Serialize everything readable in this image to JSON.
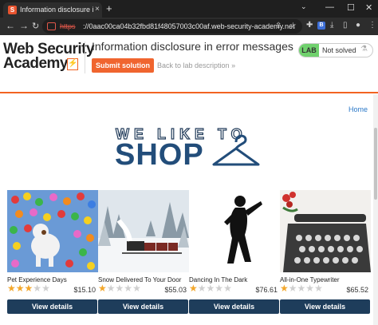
{
  "browser": {
    "tab_title": "Information disclosure in error m",
    "tab_close": "×",
    "new_tab": "+",
    "minimize": "—",
    "maximize": "☐",
    "close": "✕",
    "url_scheme": "https",
    "url": "://0aac00ca04b32fbd81f48057003c00af.web-security-academy.net"
  },
  "header": {
    "logo_line1": "Web Security",
    "logo_line2": "Academy",
    "logo_mark": "⚡",
    "lab_title": "Information disclosure in error messages",
    "submit_label": "Submit solution",
    "back_label": "Back to lab description",
    "back_arrow": "»",
    "lab_badge": "LAB",
    "status": "Not solved",
    "home_link": "Home"
  },
  "banner": {
    "we_like": "WE LIKE TO",
    "shop": "SHOP"
  },
  "products": [
    {
      "name": "Pet Experience Days",
      "rating": 3,
      "price": "$15.10",
      "button": "View details"
    },
    {
      "name": "Snow Delivered To Your Door",
      "rating": 1,
      "price": "$55.03",
      "button": "View details"
    },
    {
      "name": "Dancing In The Dark",
      "rating": 1,
      "price": "$76.61",
      "button": "View details"
    },
    {
      "name": "All-in-One Typewriter",
      "rating": 1,
      "price": "$65.52",
      "button": "View details"
    }
  ],
  "colors": {
    "accent": "#f26322",
    "nav_blue": "#1e3d5b",
    "star": "#f3a72b",
    "lab_green": "#70d16d"
  }
}
